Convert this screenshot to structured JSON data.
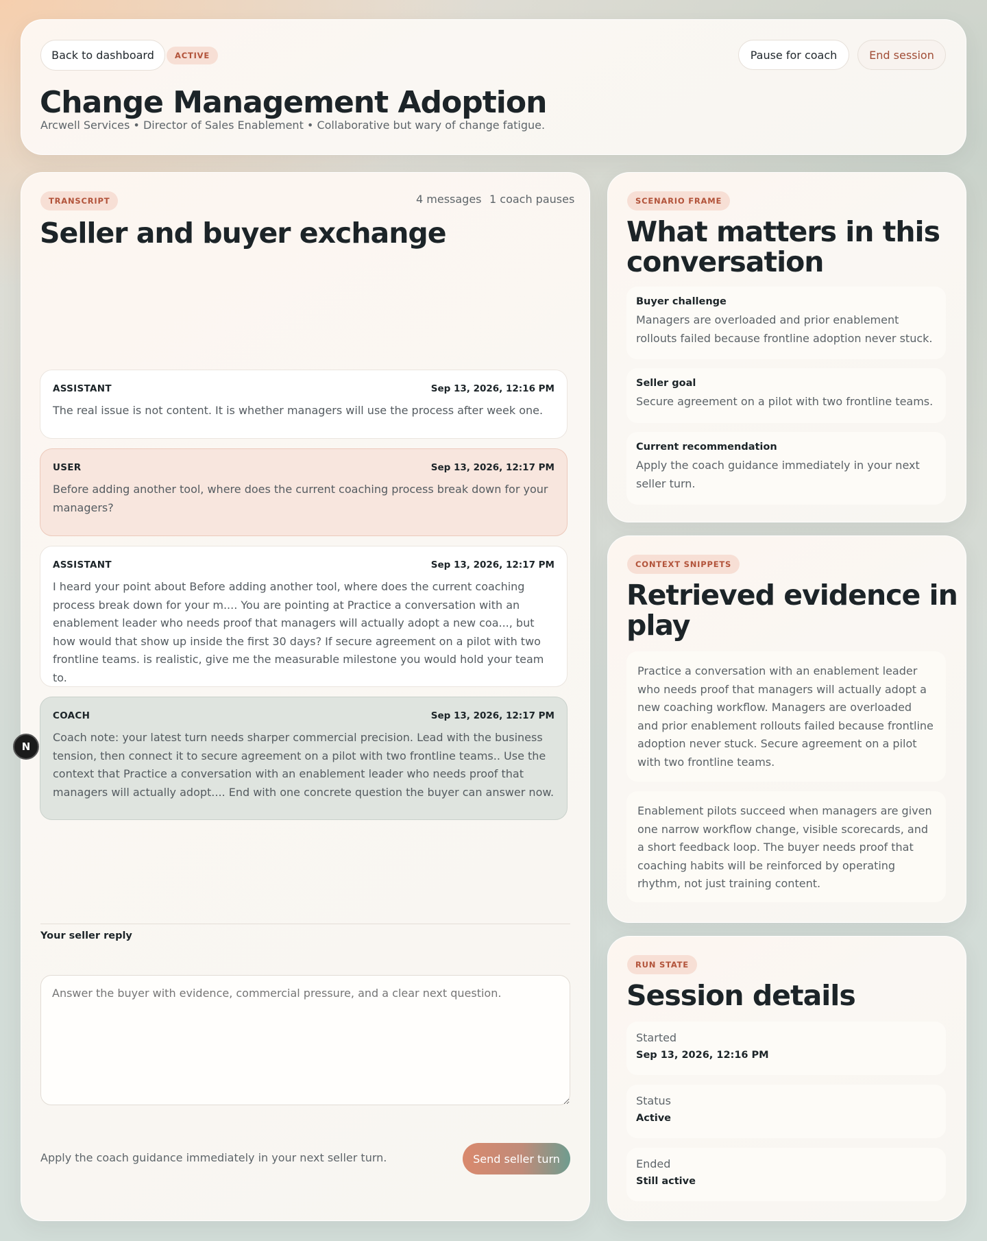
{
  "header": {
    "back_label": "Back to dashboard",
    "status_badge": "ACTIVE",
    "pause_label": "Pause for coach",
    "end_label": "End session",
    "title": "Change Management Adoption",
    "subtitle": "Arcwell Services • Director of Sales Enablement • Collaborative but wary of change fatigue."
  },
  "transcript": {
    "tag": "TRANSCRIPT",
    "message_count": "4 messages",
    "coach_pauses": "1 coach pauses",
    "title": "Seller and buyer exchange",
    "messages": [
      {
        "role": "ASSISTANT",
        "time": "Sep 13, 2026, 12:16 PM",
        "text": "The real issue is not content. It is whether managers will use the process after week one."
      },
      {
        "role": "USER",
        "time": "Sep 13, 2026, 12:17 PM",
        "text": "Before adding another tool, where does the current coaching process break down for your managers?"
      },
      {
        "role": "ASSISTANT",
        "time": "Sep 13, 2026, 12:17 PM",
        "text": "I heard your point about Before adding another tool, where does the current coaching process break down for your m.... You are pointing at Practice a conversation with an enablement leader who needs proof that managers will actually adopt a new coa..., but how would that show up inside the first 30 days? If secure agreement on a pilot with two frontline teams. is realistic, give me the measurable milestone you would hold your team to."
      },
      {
        "role": "COACH",
        "time": "Sep 13, 2026, 12:17 PM",
        "text": "Coach note: your latest turn needs sharper commercial precision. Lead with the business tension, then connect it to secure agreement on a pilot with two frontline teams.. Use the context that Practice a conversation with an enablement leader who needs proof that managers will actually adopt.... End with one concrete question the buyer can answer now."
      }
    ],
    "reply_label": "Your seller reply",
    "reply_placeholder": "Answer the buyer with evidence, commercial pressure, and a clear next question.",
    "hint": "Apply the coach guidance immediately in your next seller turn.",
    "send_label": "Send seller turn",
    "floating_badge": "N"
  },
  "scenario": {
    "tag": "SCENARIO FRAME",
    "title_line1": "What matters in this",
    "title_line2": "conversation",
    "items": [
      {
        "title": "Buyer challenge",
        "text": "Managers are overloaded and prior enablement rollouts failed because frontline adoption never stuck."
      },
      {
        "title": "Seller goal",
        "text": "Secure agreement on a pilot with two frontline teams."
      },
      {
        "title": "Current recommendation",
        "text": "Apply the coach guidance immediately in your next seller turn."
      }
    ]
  },
  "context": {
    "tag": "CONTEXT SNIPPETS",
    "title_line1": "Retrieved evidence in",
    "title_line2": "play",
    "snippets": [
      "Practice a conversation with an enablement leader who needs proof that managers will actually adopt a new coaching workflow. Managers are overloaded and prior enablement rollouts failed because frontline adoption never stuck. Secure agreement on a pilot with two frontline teams.",
      "Enablement pilots succeed when managers are given one narrow workflow change, visible scorecards, and a short feedback loop. The buyer needs proof that coaching habits will be reinforced by operating rhythm, not just training content."
    ]
  },
  "run_state": {
    "tag": "RUN STATE",
    "title": "Session details",
    "details": [
      {
        "label": "Started",
        "value": "Sep 13, 2026, 12:16 PM"
      },
      {
        "label": "Status",
        "value": "Active"
      },
      {
        "label": "Ended",
        "value": "Still active"
      }
    ]
  },
  "colors": {
    "accent": "#b2533a",
    "tag_bg": "#f7dfd5",
    "user_bubble": "#f8e6de",
    "coach_bubble": "#dfe4df",
    "send_gradient_start": "#d9896d",
    "send_gradient_end": "#6f9c8f"
  }
}
